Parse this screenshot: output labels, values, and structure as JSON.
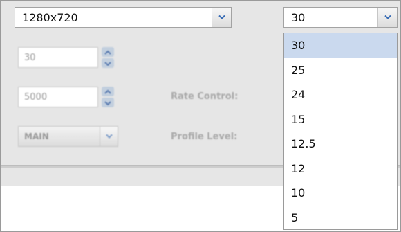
{
  "resolution": {
    "value": "1280x720",
    "icon": "chevron-down-icon"
  },
  "framerate_input": {
    "value": "30"
  },
  "bitrate_input": {
    "value": "5000"
  },
  "rate_control": {
    "label": "Rate Control:"
  },
  "profile": {
    "value": "MAIN",
    "label": "Profile Level:"
  },
  "framerate_select": {
    "value": "30",
    "options": [
      "30",
      "25",
      "24",
      "15",
      "12.5",
      "12",
      "10",
      "5"
    ],
    "selected_index": 0
  },
  "colors": {
    "panel_bg": "#e6e6e6",
    "selected_option_bg": "#cad9ee",
    "chevron": "#3a6db5",
    "spinner_btn": "#c2cfde"
  }
}
